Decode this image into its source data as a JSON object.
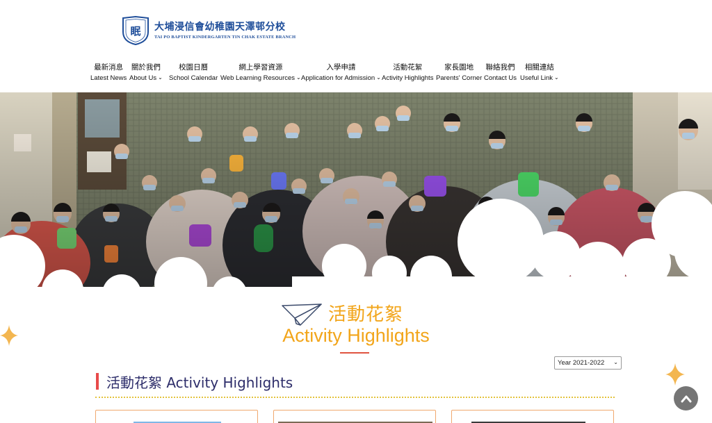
{
  "brand": {
    "name_zh": "大埔浸信會幼稚園天澤邨分校",
    "name_en": "TAI PO BAPTIST KINDERGARTEN TIN CHAK ESTATE BRANCH",
    "badge_glyph": "眠",
    "primary_color": "#1f4e9a"
  },
  "nav": {
    "items": [
      {
        "zh": "最新消息",
        "en": "Latest News",
        "dropdown": false
      },
      {
        "zh": "關於我們",
        "en": "About Us",
        "dropdown": true
      },
      {
        "zh": "校園日曆",
        "en": "School Calendar",
        "dropdown": false
      },
      {
        "zh": "網上學習資源",
        "en": "Web Learning Resources",
        "dropdown": true
      },
      {
        "zh": "入學申請",
        "en": "Application for Admission",
        "dropdown": true
      },
      {
        "zh": "活動花絮",
        "en": "Activity Highlights",
        "dropdown": false
      },
      {
        "zh": "家長園地",
        "en": "Parents' Corner",
        "dropdown": false
      },
      {
        "zh": "聯絡我們",
        "en": "Contact Us",
        "dropdown": false
      },
      {
        "zh": "相關連結",
        "en": "Useful Link",
        "dropdown": true
      }
    ]
  },
  "section": {
    "title_zh": "活動花絮",
    "title_en": "Activity Highlights",
    "accent_color": "#f2a51a",
    "underline_color": "#e0533f",
    "plane_icon": "paper-plane-icon"
  },
  "filter": {
    "selected": "Year 2021-2022"
  },
  "subsection": {
    "title": "活動花絮 Activity Highlights",
    "bar_color": "#e84a4a"
  },
  "icons": {
    "sparkle": "sparkle-icon",
    "back_to_top": "chevron-up-icon",
    "dropdown": "chevron-down-icon"
  }
}
